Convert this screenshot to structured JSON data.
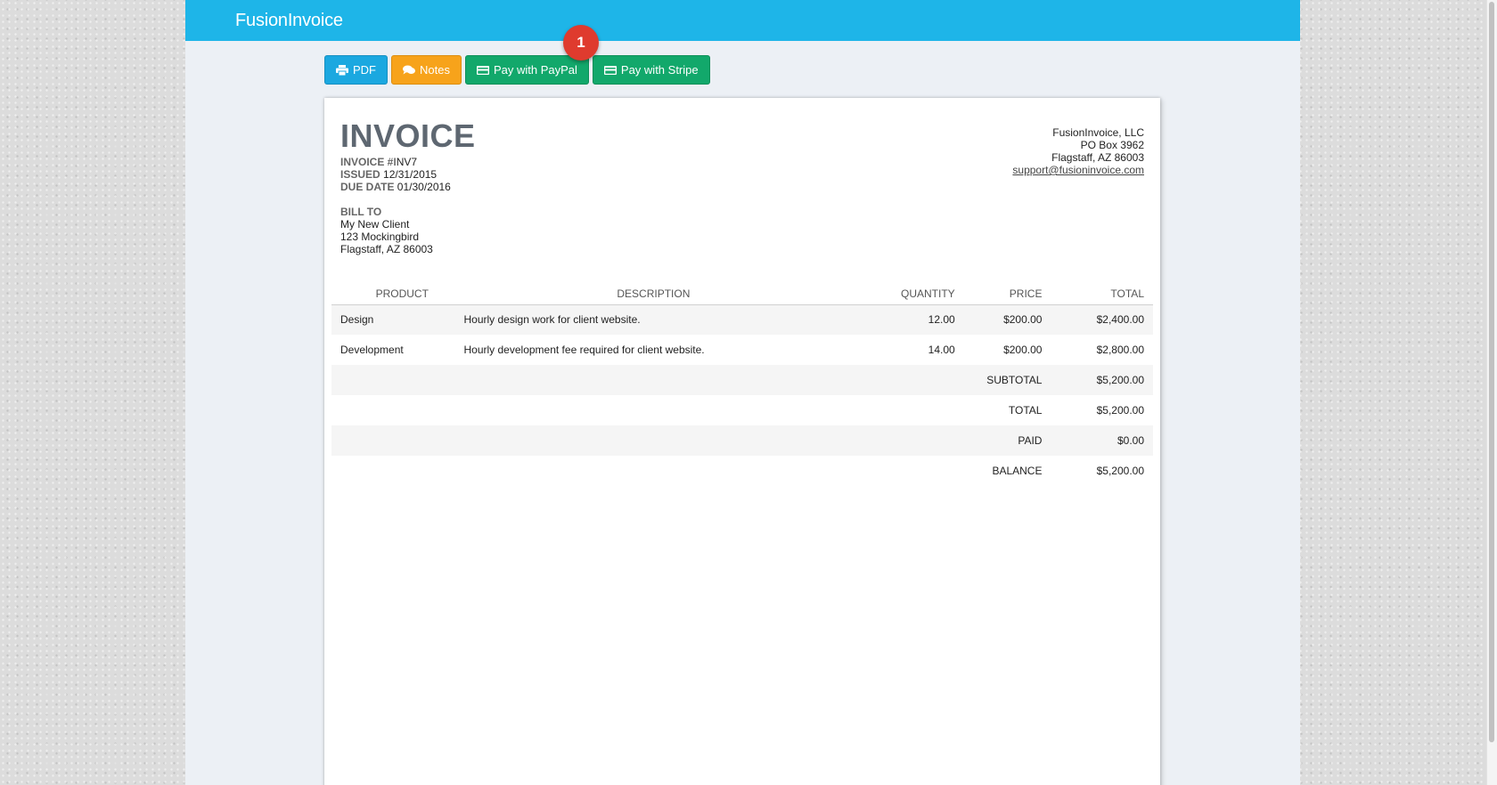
{
  "app": {
    "brand": "FusionInvoice"
  },
  "toolbar": {
    "pdf_label": "PDF",
    "notes_label": "Notes",
    "paypal_label": "Pay with PayPal",
    "stripe_label": "Pay with Stripe",
    "badge": "1",
    "colors": {
      "pdf": "#1ba8e0",
      "notes": "#f7a31b",
      "pay": "#12a86b",
      "topbar": "#1eb5e8",
      "badge": "#df3b2e"
    }
  },
  "invoice": {
    "title": "INVOICE",
    "number_label": "INVOICE #",
    "number": "INV7",
    "issued_label": "ISSUED",
    "issued": "12/31/2015",
    "due_label": "DUE DATE",
    "due": "01/30/2016",
    "bill_to_label": "BILL TO",
    "client": {
      "name": "My New Client",
      "address1": "123 Mockingbird",
      "address2": "Flagstaff, AZ 86003"
    },
    "company": {
      "name": "FusionInvoice, LLC",
      "address1": "PO Box 3962",
      "address2": "Flagstaff, AZ 86003",
      "email": "support@fusioninvoice.com"
    },
    "columns": {
      "product": "PRODUCT",
      "description": "DESCRIPTION",
      "quantity": "QUANTITY",
      "price": "PRICE",
      "total": "TOTAL"
    },
    "items": [
      {
        "product": "Design",
        "description": "Hourly design work for client website.",
        "quantity": "12.00",
        "price": "$200.00",
        "total": "$2,400.00"
      },
      {
        "product": "Development",
        "description": "Hourly development fee required for client website.",
        "quantity": "14.00",
        "price": "$200.00",
        "total": "$2,800.00"
      }
    ],
    "totals": [
      {
        "label": "SUBTOTAL",
        "value": "$5,200.00"
      },
      {
        "label": "TOTAL",
        "value": "$5,200.00"
      },
      {
        "label": "PAID",
        "value": "$0.00"
      },
      {
        "label": "BALANCE",
        "value": "$5,200.00"
      }
    ]
  }
}
